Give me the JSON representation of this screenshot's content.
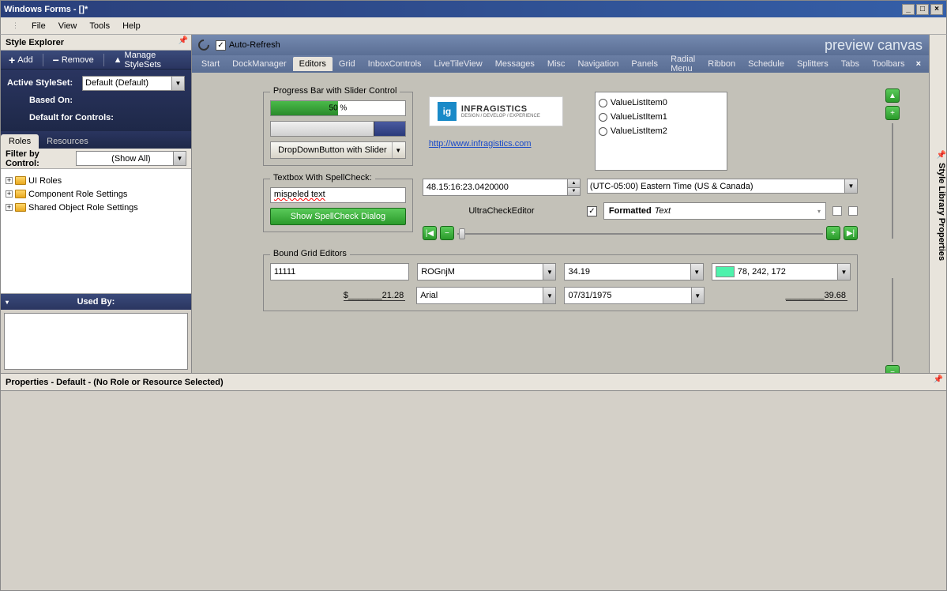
{
  "title": "Windows Forms - []*",
  "menu": [
    "File",
    "View",
    "Tools",
    "Help"
  ],
  "styleExplorer": {
    "title": "Style Explorer",
    "toolbar": {
      "add": "Add",
      "remove": "Remove",
      "manage": "Manage StyleSets"
    },
    "activeLabel": "Active StyleSet:",
    "activeValue": "Default (Default)",
    "basedOnLabel": "Based On:",
    "defaultForLabel": "Default for Controls:",
    "tabs": [
      "Roles",
      "Resources"
    ],
    "filterLabel": "Filter by Control:",
    "filterValue": "(Show All)",
    "tree": [
      "UI Roles",
      "Component Role Settings",
      "Shared Object Role Settings"
    ],
    "usedBy": "Used By:"
  },
  "preview": {
    "autoRefresh": "Auto-Refresh",
    "title": "preview canvas",
    "tabs": [
      "Start",
      "DockManager",
      "Editors",
      "Grid",
      "InboxControls",
      "LiveTileView",
      "Messages",
      "Misc",
      "Navigation",
      "Panels",
      "Radial Menu",
      "Ribbon",
      "Schedule",
      "Splitters",
      "Tabs",
      "Toolbars"
    ],
    "activeTab": "Editors"
  },
  "editors": {
    "progressLegend": "Progress Bar with Slider Control",
    "progressText": "50 %",
    "ddButton": "DropDownButton with Slider",
    "spellLegend": "Textbox With SpellCheck:",
    "spellText": "mispeled text",
    "spellBtn": "Show SpellCheck Dialog",
    "logoText": "INFRAGISTICS",
    "logoSub": "DESIGN / DEVELOP / EXPERIENCE",
    "link": "http://www.infragistics.com",
    "radios": [
      "ValueListItem0",
      "ValueListItem1",
      "ValueListItem2"
    ],
    "dateTime": "48.15:16:23.0420000",
    "tz": "(UTC-05:00) Eastern Time (US & Canada)",
    "checkLabel": "UltraCheckEditor",
    "fmtBold": "Formatted",
    "fmtItal": "Text",
    "gridLegend": "Bound Grid Editors",
    "row1": {
      "c1": "11111",
      "c2": "ROGnjM",
      "c3": "34.19",
      "c4": "78, 242, 172"
    },
    "row2": {
      "c1": "$_______21.28",
      "c2": "Arial",
      "c3": "07/31/1975",
      "c4": "________39.68"
    }
  },
  "rightPanel": "Style Library Properties",
  "propsHeader": "Properties - Default - (No Role or Resource Selected)"
}
